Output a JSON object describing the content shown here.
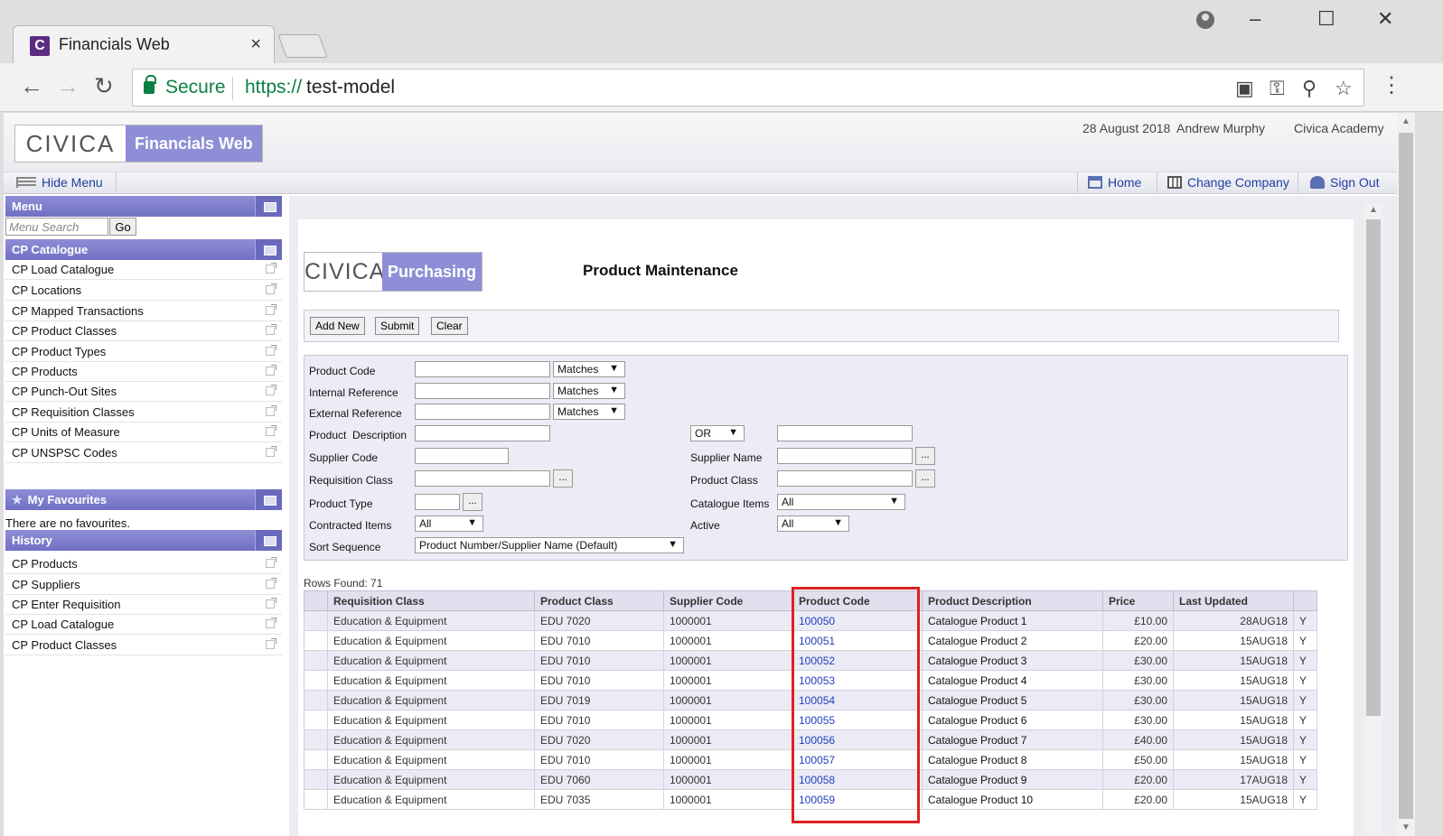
{
  "browser": {
    "tab_title": "Financials Web",
    "tab_favicon": "C",
    "close_glyph": "×",
    "secure_label": "Secure",
    "url_scheme": "https://",
    "url_host": "test-model"
  },
  "header": {
    "logo_civica": "CIVICA",
    "logo_product": "Financials Web",
    "date": "28 August 2018",
    "user": "Andrew Murphy",
    "company": "Civica Academy"
  },
  "menu_bar": {
    "hide_menu": "Hide Menu",
    "home": "Home",
    "change_company": "Change Company",
    "sign_out": "Sign Out"
  },
  "leftnav": {
    "menu_title": "Menu",
    "search_placeholder": "Menu Search",
    "go_label": "Go",
    "catalogue_title": "CP Catalogue",
    "catalogue_items": [
      "CP Load Catalogue",
      "CP Locations",
      "CP Mapped Transactions",
      "CP Product Classes",
      "CP Product Types",
      "CP Products",
      "CP Punch-Out Sites",
      "CP Requisition Classes",
      "CP Units of Measure",
      "CP UNSPSC Codes"
    ],
    "favourites_title": "My Favourites",
    "favourites_empty": "There are no favourites.",
    "history_title": "History",
    "history_items": [
      "CP Products",
      "CP Suppliers",
      "CP Enter Requisition",
      "CP Load Catalogue",
      "CP Product Classes"
    ]
  },
  "module": {
    "logo_civica": "CIVICA",
    "logo_product": "Purchasing",
    "page_title": "Product Maintenance"
  },
  "toolbar": {
    "add_new": "Add New",
    "submit": "Submit",
    "clear": "Clear"
  },
  "criteria": {
    "product_code": "Product Code",
    "internal_reference": "Internal Reference",
    "external_reference": "External Reference",
    "product_description": "Product  Description",
    "supplier_code": "Supplier Code",
    "requisition_class": "Requisition Class",
    "product_type": "Product Type",
    "contracted_items": "Contracted Items",
    "sort_sequence": "Sort Sequence",
    "supplier_name": "Supplier Name",
    "product_class": "Product Class",
    "catalogue_items": "Catalogue Items",
    "active": "Active",
    "matches": "Matches",
    "or": "OR",
    "all": "All",
    "sort_default": "Product Number/Supplier Name (Default)",
    "lookup": "..."
  },
  "results": {
    "rows_found": "Rows Found: 71",
    "columns": [
      "Requisition Class",
      "Product Class",
      "Supplier Code",
      "Product Code",
      "Product Description",
      "Price",
      "Last Updated"
    ],
    "rows": [
      [
        "Education & Equipment",
        "EDU 7020",
        "1000001",
        "100050",
        "Catalogue Product 1",
        "£10.00",
        "28AUG18",
        "Y"
      ],
      [
        "Education & Equipment",
        "EDU 7010",
        "1000001",
        "100051",
        "Catalogue Product 2",
        "£20.00",
        "15AUG18",
        "Y"
      ],
      [
        "Education & Equipment",
        "EDU 7010",
        "1000001",
        "100052",
        "Catalogue Product 3",
        "£30.00",
        "15AUG18",
        "Y"
      ],
      [
        "Education & Equipment",
        "EDU 7010",
        "1000001",
        "100053",
        "Catalogue Product 4",
        "£30.00",
        "15AUG18",
        "Y"
      ],
      [
        "Education & Equipment",
        "EDU 7019",
        "1000001",
        "100054",
        "Catalogue Product 5",
        "£30.00",
        "15AUG18",
        "Y"
      ],
      [
        "Education & Equipment",
        "EDU 7010",
        "1000001",
        "100055",
        "Catalogue Product 6",
        "£30.00",
        "15AUG18",
        "Y"
      ],
      [
        "Education & Equipment",
        "EDU 7020",
        "1000001",
        "100056",
        "Catalogue Product 7",
        "£40.00",
        "15AUG18",
        "Y"
      ],
      [
        "Education & Equipment",
        "EDU 7010",
        "1000001",
        "100057",
        "Catalogue Product 8",
        "£50.00",
        "15AUG18",
        "Y"
      ],
      [
        "Education & Equipment",
        "EDU 7060",
        "1000001",
        "100058",
        "Catalogue Product 9",
        "£20.00",
        "17AUG18",
        "Y"
      ],
      [
        "Education & Equipment",
        "EDU 7035",
        "1000001",
        "100059",
        "Catalogue Product 10",
        "£20.00",
        "15AUG18",
        "Y"
      ]
    ]
  },
  "colors": {
    "brand_purple": "#8e8ed6",
    "link_blue": "#1f3fbf",
    "highlight_red": "#e02020",
    "secure_green": "#0b8043"
  },
  "icons": {
    "tab": "civica-favicon",
    "back": "back-arrow-icon",
    "forward": "forward-arrow-icon",
    "reload": "reload-icon",
    "lock": "lock-icon",
    "popup_blocked": "popup-blocked-icon",
    "key": "key-icon",
    "zoom": "zoom-icon",
    "bookmark": "star-icon",
    "home": "home-icon",
    "company": "building-icon",
    "sign_out": "user-icon"
  }
}
